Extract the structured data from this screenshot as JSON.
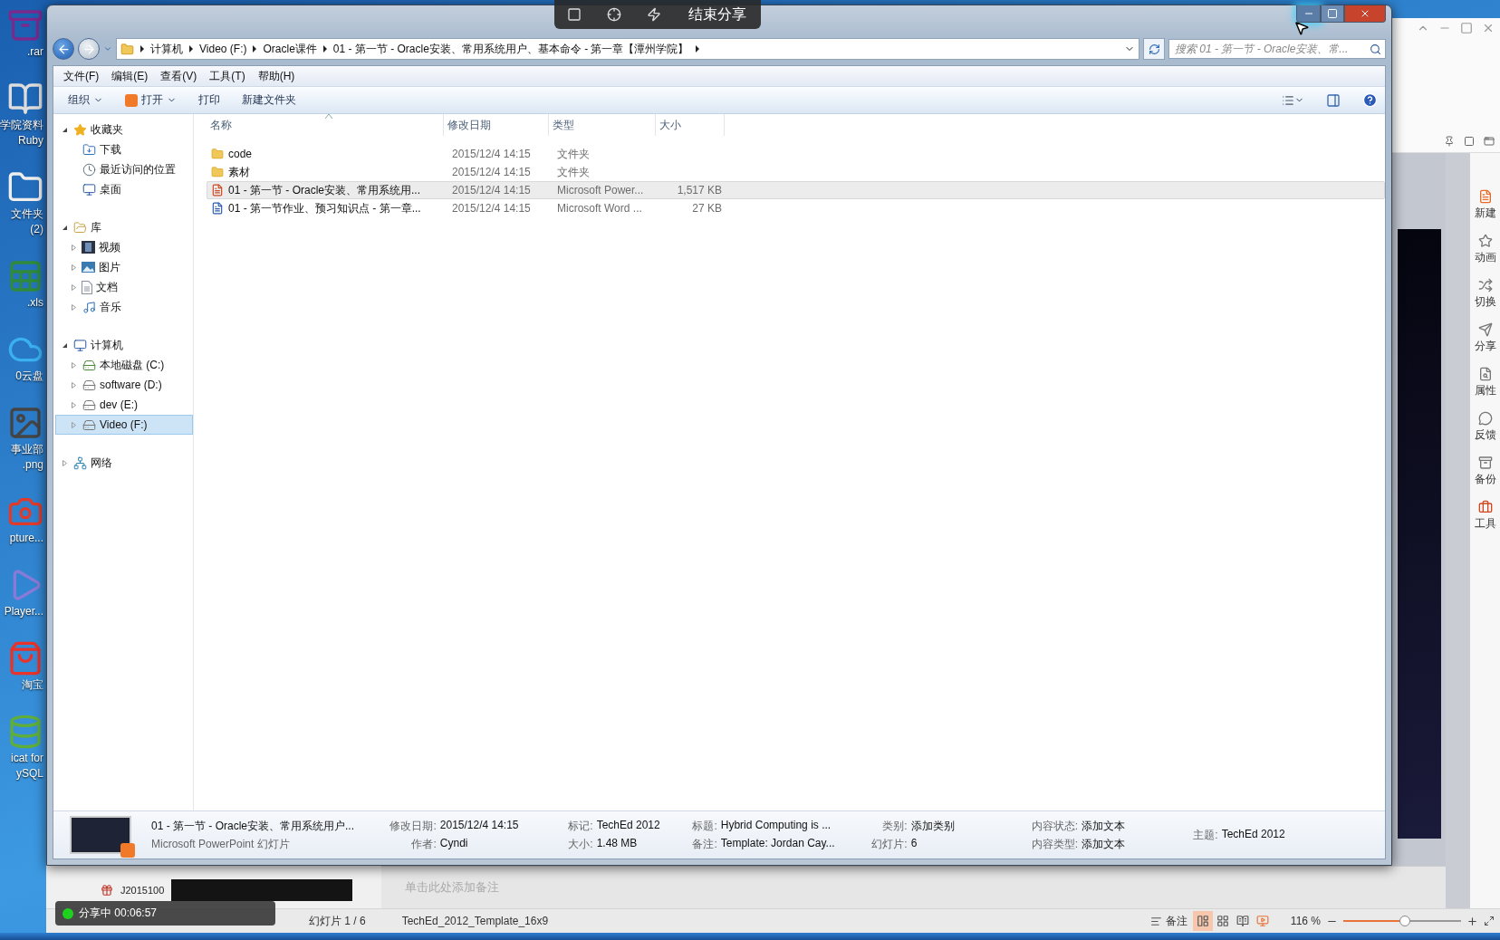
{
  "share_bar": {
    "tools": [
      {
        "kind": "region"
      },
      {
        "kind": "crosshair"
      },
      {
        "kind": "bolt"
      }
    ],
    "end_label": "结束分享"
  },
  "desktop_icons": [
    {
      "kind": "archive",
      "lines": [
        ".rar"
      ]
    },
    {
      "kind": "book",
      "lines": [
        "学院资料",
        "Ruby"
      ]
    },
    {
      "kind": "folder",
      "lines": [
        "文件夹",
        "(2)"
      ]
    },
    {
      "kind": "spreadsheet",
      "lines": [
        ".xls"
      ]
    },
    {
      "kind": "cloud",
      "lines": [
        "0云盘"
      ]
    },
    {
      "kind": "image",
      "lines": [
        "事业部",
        ".png"
      ]
    },
    {
      "kind": "capture",
      "lines": [
        "pture..."
      ]
    },
    {
      "kind": "player",
      "lines": [
        "Player..."
      ]
    },
    {
      "kind": "shop",
      "lines": [
        "淘宝"
      ]
    },
    {
      "kind": "database",
      "lines": [
        "icat for",
        "ySQL"
      ]
    }
  ],
  "presentation": {
    "window_controls": [
      {
        "kind": "collapse"
      },
      {
        "kind": "minimize"
      },
      {
        "kind": "maximize"
      },
      {
        "kind": "close"
      }
    ],
    "ribbon_tools": [
      {
        "kind": "pin"
      },
      {
        "kind": "square"
      },
      {
        "kind": "window"
      }
    ],
    "side_panel": [
      {
        "kind": "new",
        "label": "新建"
      },
      {
        "kind": "animation",
        "label": "动画"
      },
      {
        "kind": "transition",
        "label": "切换"
      },
      {
        "kind": "share",
        "label": "分享"
      },
      {
        "kind": "properties",
        "label": "属性"
      },
      {
        "kind": "feedback",
        "label": "反馈"
      },
      {
        "kind": "backup",
        "label": "备份"
      },
      {
        "kind": "tools",
        "label": "工具"
      }
    ],
    "thumbnail_tag": "J2015100",
    "notes_placeholder": "单击此处添加备注",
    "slide_counter": "幻灯片 1 / 6",
    "template_name": "TechEd_2012_Template_16x9",
    "notes_button": "备注",
    "views": [
      {
        "kind": "normal",
        "selected": true
      },
      {
        "kind": "sorter",
        "selected": false
      },
      {
        "kind": "reading",
        "selected": false
      },
      {
        "kind": "slideshow",
        "selected": false
      }
    ],
    "zoom_label": "116 %",
    "zoom": {
      "level": 0.52
    }
  },
  "share_status": {
    "label": "分享中 00:06:57"
  },
  "explorer": {
    "window_controls": [
      {
        "kind": "minimize",
        "highlighted": true
      },
      {
        "kind": "maximize",
        "highlighted": false
      },
      {
        "kind": "close",
        "highlighted": false
      }
    ],
    "breadcrumb": [
      "计算机",
      "Video (F:)",
      "Oracle课件",
      "01 - 第一节 - Oracle安装、常用系统用户、基本命令 - 第一章【潭州学院】"
    ],
    "search": {
      "placeholder": "搜索 01 - 第一节 - Oracle安装、常..."
    },
    "menus": [
      "文件(F)",
      "编辑(E)",
      "查看(V)",
      "工具(T)",
      "帮助(H)"
    ],
    "commands": [
      {
        "kind": "menu",
        "label": "组织"
      },
      {
        "kind": "split",
        "label": "打开"
      },
      {
        "kind": "plain",
        "label": "打印"
      },
      {
        "kind": "plain",
        "label": "新建文件夹"
      }
    ],
    "nav": [
      {
        "kind": "favorites",
        "label": "收藏夹",
        "expanded": true,
        "selected": false,
        "children": [
          {
            "kind": "downloads",
            "label": "下载",
            "selected": false
          },
          {
            "kind": "recent",
            "label": "最近访问的位置",
            "selected": false
          },
          {
            "kind": "desktop",
            "label": "桌面",
            "selected": false
          }
        ]
      },
      {
        "kind": "library",
        "label": "库",
        "expanded": true,
        "selected": false,
        "children": [
          {
            "kind": "videos",
            "label": "视频",
            "expanded": false,
            "selected": false
          },
          {
            "kind": "pictures",
            "label": "图片",
            "expanded": false,
            "selected": false
          },
          {
            "kind": "documents",
            "label": "文档",
            "expanded": false,
            "selected": false
          },
          {
            "kind": "music",
            "label": "音乐",
            "expanded": false,
            "selected": false
          }
        ]
      },
      {
        "kind": "computer",
        "label": "计算机",
        "expanded": true,
        "selected": false,
        "children": [
          {
            "kind": "system-drive",
            "label": "本地磁盘 (C:)",
            "expanded": false,
            "selected": false
          },
          {
            "kind": "drive",
            "label": "software (D:)",
            "expanded": false,
            "selected": false
          },
          {
            "kind": "drive",
            "label": "dev (E:)",
            "expanded": false,
            "selected": false
          },
          {
            "kind": "drive",
            "label": "Video (F:)",
            "expanded": false,
            "selected": true
          }
        ]
      },
      {
        "kind": "network",
        "label": "网络",
        "expanded": false,
        "selected": false
      }
    ],
    "columns": [
      {
        "label": "名称",
        "sorted": true
      },
      {
        "label": "修改日期",
        "sorted": false
      },
      {
        "label": "类型",
        "sorted": false
      },
      {
        "label": "大小",
        "sorted": false
      }
    ],
    "files": [
      {
        "kind": "folder",
        "name": "code",
        "date": "2015/12/4 14:15",
        "type": "文件夹",
        "selected": false
      },
      {
        "kind": "folder",
        "name": "素材",
        "date": "2015/12/4 14:15",
        "type": "文件夹",
        "selected": false
      },
      {
        "kind": "powerpoint",
        "name": "01 - 第一节 - Oracle安装、常用系统用...",
        "date": "2015/12/4 14:15",
        "type": "Microsoft Power...",
        "size": "1,517 KB",
        "selected": true
      },
      {
        "kind": "word",
        "name": "01 - 第一节作业、预习知识点 - 第一章...",
        "date": "2015/12/4 14:15",
        "type": "Microsoft Word ...",
        "size": "27 KB",
        "selected": false
      }
    ],
    "details": {
      "title": "01 - 第一节 - Oracle安装、常用系统用户...",
      "subtitle": "Microsoft PowerPoint 幻灯片",
      "columns": [
        [
          {
            "label": "修改日期:",
            "value": "2015/12/4 14:15"
          },
          {
            "label": "作者:",
            "value": "Cyndi"
          }
        ],
        [
          {
            "label": "标记:",
            "value": "TechEd 2012"
          },
          {
            "label": "大小:",
            "value": "1.48 MB"
          }
        ],
        [
          {
            "label": "标题:",
            "value": "Hybrid Computing is ..."
          },
          {
            "label": "备注:",
            "value": "Template: Jordan Cay..."
          }
        ],
        [
          {
            "label": "类别:",
            "value": "添加类别"
          },
          {
            "label": "幻灯片:",
            "value": "6"
          }
        ],
        [
          {
            "label": "内容状态:",
            "value": "添加文本"
          },
          {
            "label": "内容类型:",
            "value": "添加文本"
          }
        ],
        [
          {
            "label": "主题:",
            "value": "TechEd 2012"
          }
        ]
      ]
    }
  }
}
